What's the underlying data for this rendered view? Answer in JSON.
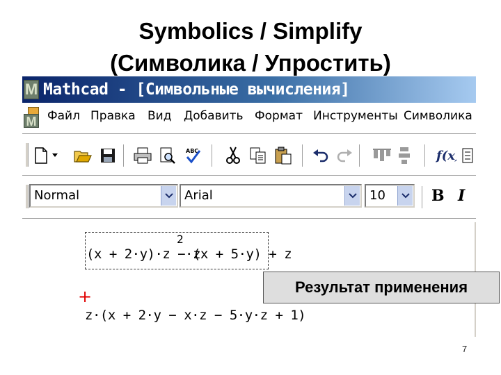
{
  "slide": {
    "title_line1": "Symbolics / Simplify",
    "title_line2": "(Символика / Упростить)",
    "page_number": "7"
  },
  "window": {
    "title": "Mathcad - [Символьные вычисления]",
    "title_color": "#0a246a"
  },
  "menu": {
    "items": [
      "Файл",
      "Правка",
      "Вид",
      "Добавить",
      "Формат",
      "Инструменты",
      "Символика"
    ]
  },
  "toolbar": {
    "icons": [
      "new-document-icon",
      "dropdown-arrow-icon",
      "open-folder-icon",
      "save-icon",
      "print-icon",
      "print-preview-icon",
      "spell-check-icon",
      "cut-icon",
      "copy-icon",
      "paste-icon",
      "undo-icon",
      "redo-icon",
      "align-icon",
      "align-vertical-icon",
      "insert-function-icon",
      "insert-units-icon"
    ],
    "spell_label": "ABC",
    "function_label": "f(x)"
  },
  "format_bar": {
    "style": "Normal",
    "font": "Arial",
    "size": "10",
    "bold_label": "B",
    "italic_label": "I"
  },
  "worksheet": {
    "expression_part1": "(x + 2·y)·z − z",
    "expression_exponent": "2",
    "expression_part2": "·(x + 5·y) + z",
    "result": "z·(x + 2·y − x·z − 5·y·z + 1)",
    "crosshair": "+"
  },
  "callout": {
    "text": "Результат применения"
  }
}
